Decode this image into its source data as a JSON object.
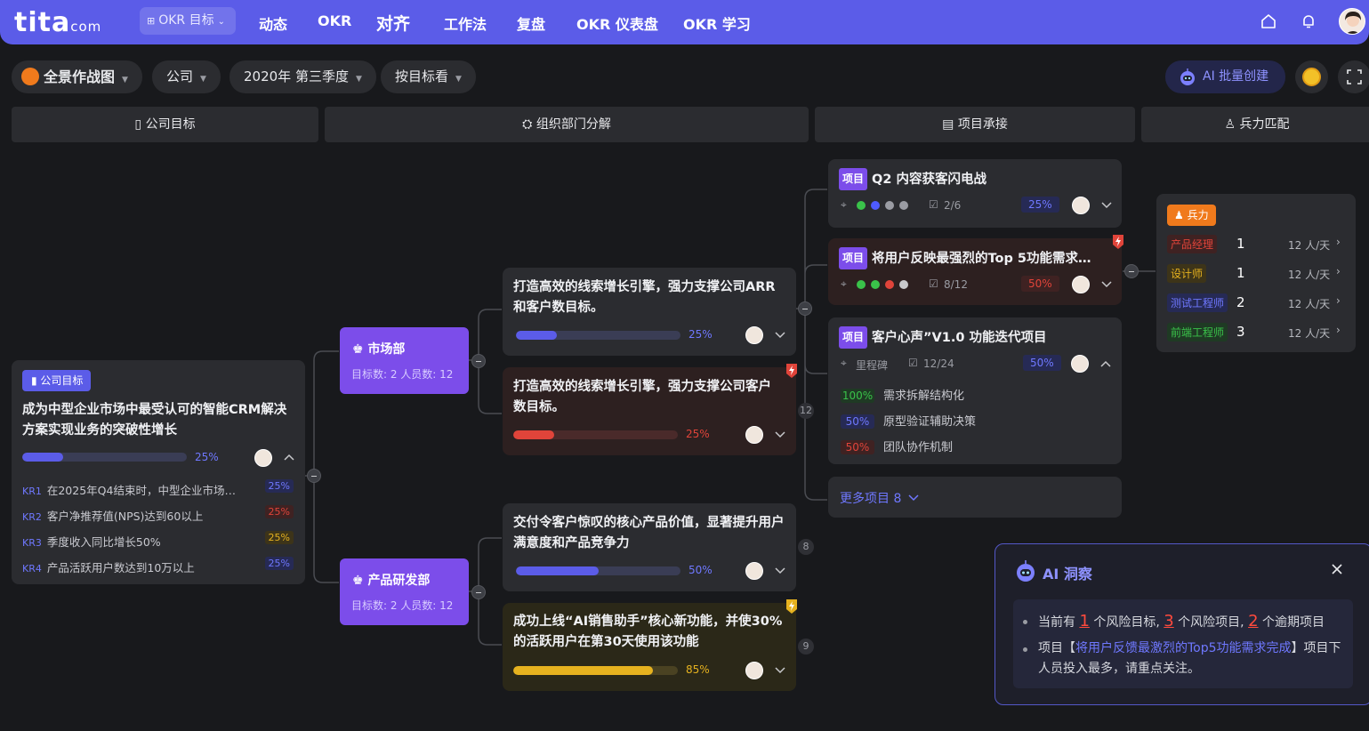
{
  "header": {
    "logo_main": "tita",
    "logo_suffix": "com",
    "select_label": "OKR 目标",
    "nav": [
      "动态",
      "OKR",
      "对齐",
      "工作法",
      "复盘",
      "OKR 仪表盘",
      "OKR 学习"
    ]
  },
  "filters": {
    "view": "全景作战图",
    "scope": "公司",
    "period": "2020年 第三季度",
    "mode": "按目标看",
    "ai_batch": "AI 批量创建"
  },
  "columns": [
    "公司目标",
    "组织部门分解",
    "项目承接",
    "兵力匹配"
  ],
  "company_goal": {
    "tag": "公司目标",
    "title": "成为中型企业市场中最受认可的智能CRM解决方案实现业务的突破性增长",
    "progress": 25,
    "progress_label": "25%",
    "krs": [
      {
        "label": "KR1",
        "text": "在2025年Q4结束时，中型企业市场…",
        "pct": "25%",
        "color": "#4e5bff"
      },
      {
        "label": "KR2",
        "text": "客户净推荐值(NPS)达到60以上",
        "pct": "25%",
        "color": "#e0443a"
      },
      {
        "label": "KR3",
        "text": "季度收入同比增长50%",
        "pct": "25%",
        "color": "#e6b21f"
      },
      {
        "label": "KR4",
        "text": "产品活跃用户数达到10万以上",
        "pct": "25%",
        "color": "#4e5bff"
      }
    ]
  },
  "departments": [
    {
      "name": "市场部",
      "sub": "目标数: 2    人员数: 12"
    },
    {
      "name": "产品研发部",
      "sub": "目标数: 2    人员数: 12"
    }
  ],
  "dept_goals": [
    {
      "title": "打造高效的线索增长引擎，强力支撑公司ARR和客户数目标。",
      "progress": 25,
      "pct": "25%",
      "status": "normal"
    },
    {
      "title": "打造高效的线索增长引擎，强力支撑公司客户数目标。",
      "progress": 25,
      "pct": "25%",
      "status": "danger"
    },
    {
      "title": "交付令客户惊叹的核心产品价值，显著提升用户满意度和产品竞争力",
      "progress": 50,
      "pct": "50%",
      "status": "normal"
    },
    {
      "title": "成功上线“AI销售助手”核心新功能，并使30%的活跃用户在第30天使用该功能",
      "progress": 85,
      "pct": "85%",
      "status": "warn"
    }
  ],
  "counts": [
    "12",
    "8",
    "9"
  ],
  "projects": [
    {
      "tag": "项目",
      "title": "Q2 内容获客闪电战",
      "tasks": "2/6",
      "pct": "25%"
    },
    {
      "tag": "项目",
      "title": "将用户反映最强烈的Top 5功能需求…",
      "tasks": "8/12",
      "pct": "50%"
    },
    {
      "tag": "项目",
      "title": "客户心声”V1.0 功能迭代项目",
      "milestone": "里程碑",
      "tasks": "12/24",
      "pct": "50%",
      "subs": [
        {
          "pct": "100%",
          "text": "需求拆解结构化"
        },
        {
          "pct": "50%",
          "text": "原型验证辅助决策"
        },
        {
          "pct": "50%",
          "text": "团队协作机制"
        }
      ]
    }
  ],
  "more_projects": "更多项目 8",
  "resources": {
    "tag": "兵力",
    "rows": [
      {
        "role": "产品经理",
        "num": "1",
        "rate": "12 人/天"
      },
      {
        "role": "设计师",
        "num": "1",
        "rate": "12 人/天"
      },
      {
        "role": "测试工程师",
        "num": "2",
        "rate": "12 人/天"
      },
      {
        "role": "前端工程师",
        "num": "3",
        "rate": "12 人/天"
      }
    ]
  },
  "ai_insight": {
    "title": "AI 洞察",
    "line1_a": "当前有",
    "risk_goals": "1",
    "line1_b": "个风险目标,",
    "risk_projects": "3",
    "line1_c": "个风险项目,",
    "overdue": "2",
    "line1_d": "个逾期项目",
    "line2_a": "项目【",
    "line2_link": "将用户反馈最激烈的Top5功能需求完成",
    "line2_b": "】项目下人员投入最多，请重点关注。"
  },
  "colors": {
    "brand": "#5b5ce8",
    "purple": "#7c4dea",
    "danger": "#e0443a",
    "warn": "#e6b21f",
    "blue": "#4e5bff",
    "green": "#3ac24a"
  }
}
